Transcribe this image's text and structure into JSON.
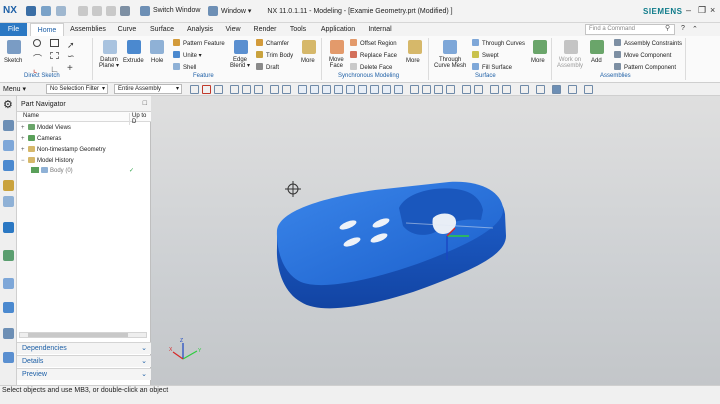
{
  "app": {
    "logo": "NX",
    "window_title": "NX 11.0.1.11 - Modeling - [Examie Geometry.prt (Modified) ]",
    "brand": "SIEMENS"
  },
  "titlebar": {
    "switch_window": "Switch Window",
    "window_menu": "Window ▾"
  },
  "tabs": [
    {
      "label": "File"
    },
    {
      "label": "Home"
    },
    {
      "label": "Assemblies"
    },
    {
      "label": "Curve"
    },
    {
      "label": "Surface"
    },
    {
      "label": "Analysis"
    },
    {
      "label": "View"
    },
    {
      "label": "Render"
    },
    {
      "label": "Tools"
    },
    {
      "label": "Application"
    },
    {
      "label": "Internal"
    }
  ],
  "search": {
    "placeholder": "Find a Command"
  },
  "ribbon": {
    "groups": {
      "direct_sketch": "Direct Sketch",
      "feature": "Feature",
      "sync": "Synchronous Modeling",
      "surface": "Surface",
      "assemblies": "Assemblies"
    },
    "sketch": "Sketch",
    "datum_plane": "Datum\nPlane ▾",
    "extrude": "Extrude",
    "hole": "Hole",
    "pattern_feature": "Pattern Feature",
    "unite": "Unite ▾",
    "shell": "Shell",
    "edge_blend": "Edge\nBlend ▾",
    "chamfer": "Chamfer",
    "trim_body": "Trim Body",
    "draft": "Draft",
    "more": "More",
    "move_face": "Move\nFace",
    "offset_region": "Offset Region",
    "replace_face": "Replace Face",
    "delete_face": "Delete Face",
    "through_curve_mesh": "Through\nCurve Mesh",
    "through_curves": "Through Curves",
    "swept": "Swept",
    "fill_surface": "Fill Surface",
    "work_on_assembly": "Work on\nAssembly",
    "add": "Add",
    "assembly_constraints": "Assembly Constraints",
    "move_component": "Move Component",
    "pattern_component": "Pattern Component"
  },
  "selection_bar": {
    "menu": "Menu ▾",
    "filter": "No Selection Filter",
    "scope": "Entire Assembly"
  },
  "navigator": {
    "title": "Part Navigator",
    "columns": {
      "name": "Name",
      "up_to_date": "Up to D"
    },
    "items": [
      {
        "label": "Model Views"
      },
      {
        "label": "Cameras"
      },
      {
        "label": "Non-timestamp Geometry"
      },
      {
        "label": "Model History"
      },
      {
        "label": "Body (0)",
        "status": "✓"
      }
    ],
    "panels": {
      "dependencies": "Dependencies",
      "details": "Details",
      "preview": "Preview"
    }
  },
  "status": {
    "text": "Select objects and use MB3, or double-click an object"
  },
  "colors": {
    "accent": "#2b78c3",
    "model": "#1f6bd6",
    "group_label": "#1d5fa6"
  }
}
